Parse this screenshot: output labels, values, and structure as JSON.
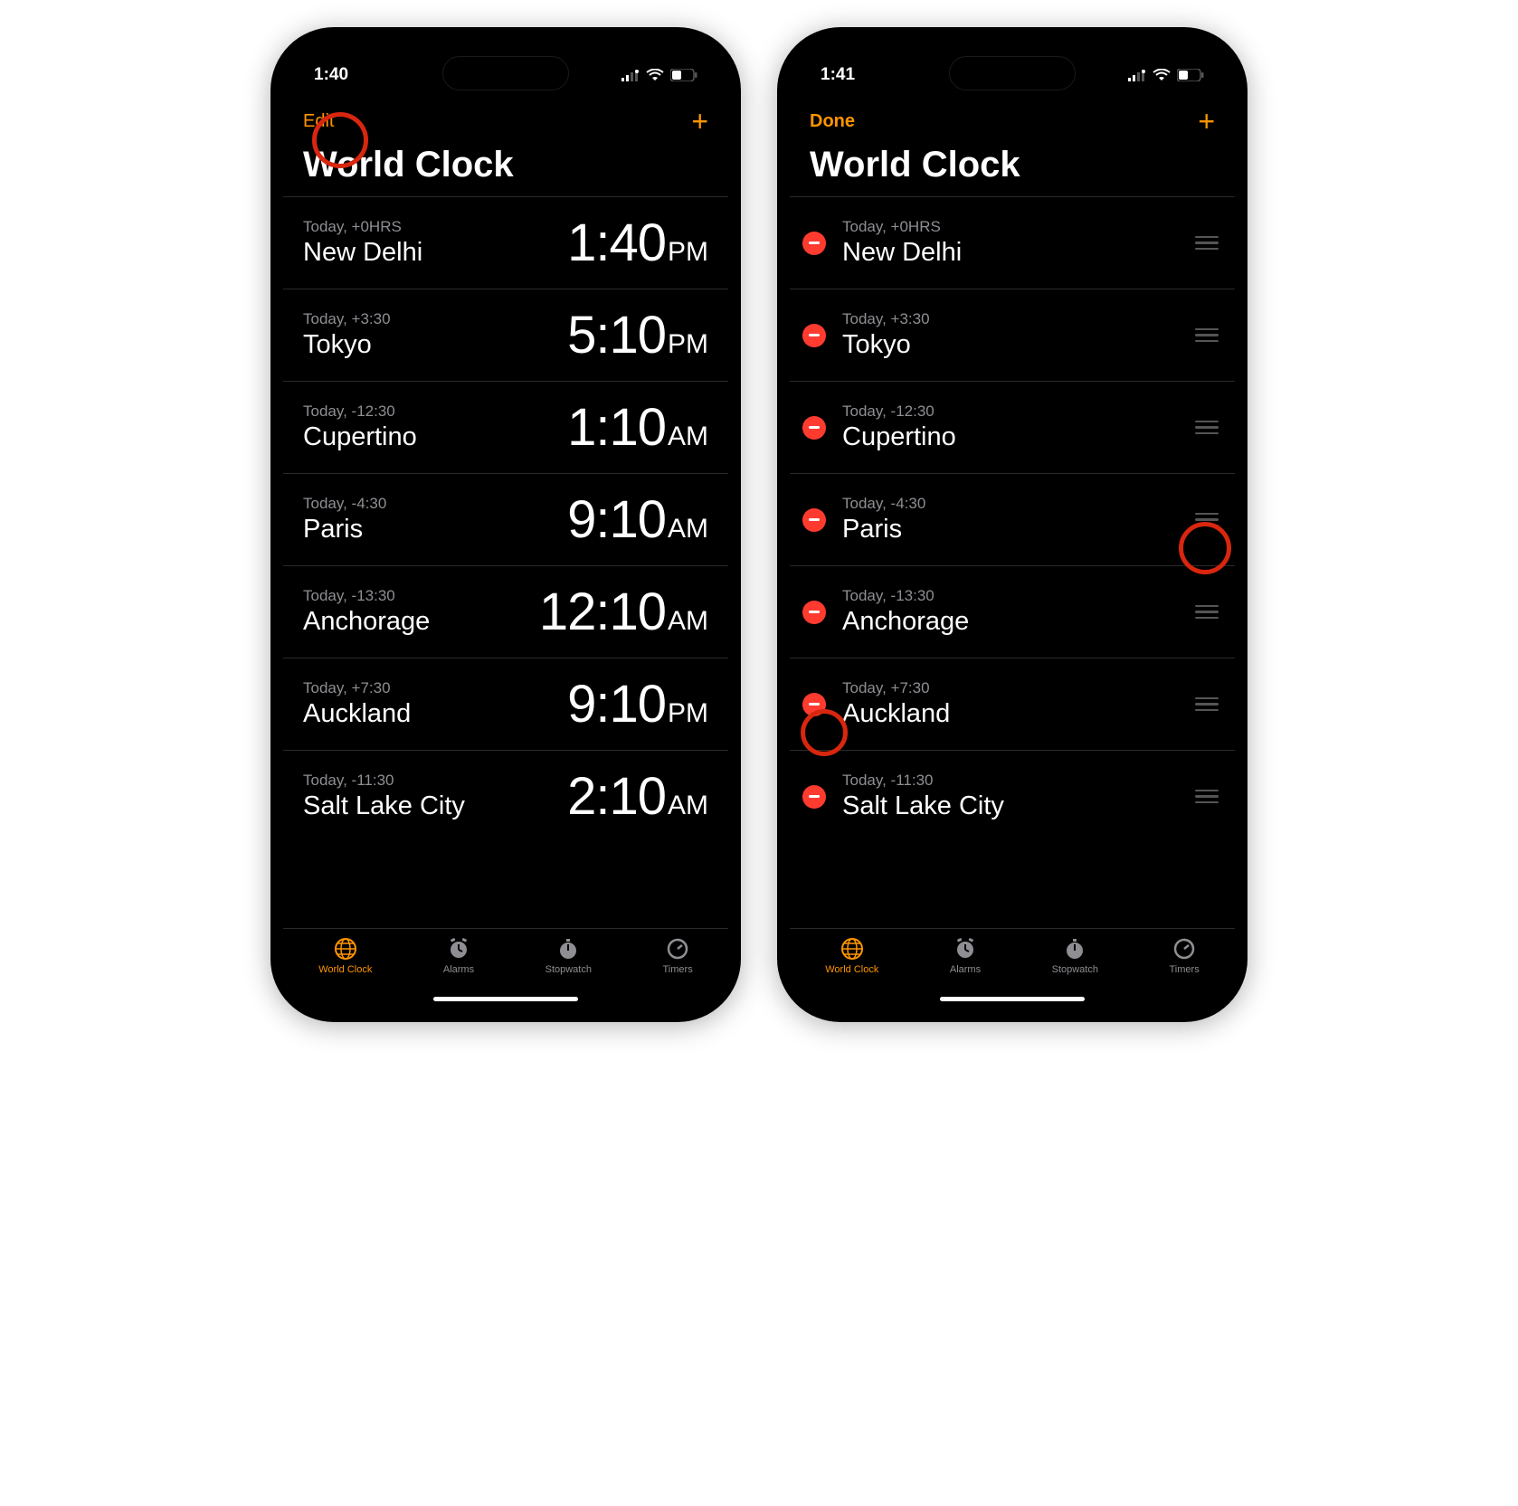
{
  "left": {
    "status_time": "1:40",
    "nav_button": "Edit",
    "title": "World Clock",
    "rows": [
      {
        "offset": "Today, +0HRS",
        "city": "New Delhi",
        "time": "1:40",
        "ampm": "PM"
      },
      {
        "offset": "Today, +3:30",
        "city": "Tokyo",
        "time": "5:10",
        "ampm": "PM"
      },
      {
        "offset": "Today, -12:30",
        "city": "Cupertino",
        "time": "1:10",
        "ampm": "AM"
      },
      {
        "offset": "Today, -4:30",
        "city": "Paris",
        "time": "9:10",
        "ampm": "AM"
      },
      {
        "offset": "Today, -13:30",
        "city": "Anchorage",
        "time": "12:10",
        "ampm": "AM"
      },
      {
        "offset": "Today, +7:30",
        "city": "Auckland",
        "time": "9:10",
        "ampm": "PM"
      },
      {
        "offset": "Today, -11:30",
        "city": "Salt Lake City",
        "time": "2:10",
        "ampm": "AM"
      }
    ]
  },
  "right": {
    "status_time": "1:41",
    "nav_button": "Done",
    "title": "World Clock",
    "rows": [
      {
        "offset": "Today, +0HRS",
        "city": "New Delhi"
      },
      {
        "offset": "Today, +3:30",
        "city": "Tokyo"
      },
      {
        "offset": "Today, -12:30",
        "city": "Cupertino"
      },
      {
        "offset": "Today, -4:30",
        "city": "Paris"
      },
      {
        "offset": "Today, -13:30",
        "city": "Anchorage"
      },
      {
        "offset": "Today, +7:30",
        "city": "Auckland"
      },
      {
        "offset": "Today, -11:30",
        "city": "Salt Lake City"
      }
    ]
  },
  "tabs": [
    {
      "label": "World Clock",
      "active": true
    },
    {
      "label": "Alarms",
      "active": false
    },
    {
      "label": "Stopwatch",
      "active": false
    },
    {
      "label": "Timers",
      "active": false
    }
  ],
  "accent": "#ff9500"
}
